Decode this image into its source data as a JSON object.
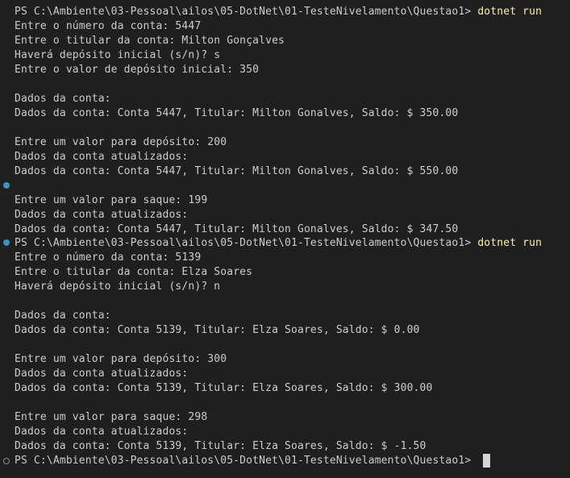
{
  "terminal": {
    "lines": [
      {
        "prompt": "PS C:\\Ambiente\\03-Pessoal\\ailos\\05-DotNet\\01-TesteNivelamento\\Questao1> ",
        "command": "dotnet run"
      },
      {
        "text": "Entre o número da conta: 5447"
      },
      {
        "text": "Entre o titular da conta: Milton Gonçalves"
      },
      {
        "text": "Haverá depósito inicial (s/n)? s"
      },
      {
        "text": "Entre o valor de depósito inicial: 350"
      },
      {
        "text": ""
      },
      {
        "text": "Dados da conta:"
      },
      {
        "text": "Dados da conta: Conta 5447, Titular: Milton Gonalves, Saldo: $ 350.00"
      },
      {
        "text": ""
      },
      {
        "text": "Entre um valor para depósito: 200"
      },
      {
        "text": "Dados da conta atualizados:"
      },
      {
        "text": "Dados da conta: Conta 5447, Titular: Milton Gonalves, Saldo: $ 550.00"
      },
      {
        "text": ""
      },
      {
        "text": "Entre um valor para saque: 199"
      },
      {
        "text": "Dados da conta atualizados:"
      },
      {
        "text": "Dados da conta: Conta 5447, Titular: Milton Gonalves, Saldo: $ 347.50"
      },
      {
        "prompt": "PS C:\\Ambiente\\03-Pessoal\\ailos\\05-DotNet\\01-TesteNivelamento\\Questao1> ",
        "command": "dotnet run"
      },
      {
        "text": "Entre o número da conta: 5139"
      },
      {
        "text": "Entre o titular da conta: Elza Soares"
      },
      {
        "text": "Haverá depósito inicial (s/n)? n"
      },
      {
        "text": ""
      },
      {
        "text": "Dados da conta:"
      },
      {
        "text": "Dados da conta: Conta 5139, Titular: Elza Soares, Saldo: $ 0.00"
      },
      {
        "text": ""
      },
      {
        "text": "Entre um valor para depósito: 300"
      },
      {
        "text": "Dados da conta atualizados:"
      },
      {
        "text": "Dados da conta: Conta 5139, Titular: Elza Soares, Saldo: $ 300.00"
      },
      {
        "text": ""
      },
      {
        "text": "Entre um valor para saque: 298"
      },
      {
        "text": "Dados da conta atualizados:"
      },
      {
        "text": "Dados da conta: Conta 5139, Titular: Elza Soares, Saldo: $ -1.50"
      },
      {
        "prompt": "PS C:\\Ambiente\\03-Pessoal\\ailos\\05-DotNet\\01-TesteNivelamento\\Questao1> ",
        "command": ""
      }
    ]
  },
  "colors": {
    "background": "#1f1f1f",
    "text": "#cccccc",
    "command": "#f9f1a5",
    "marker_done": "#3794c6"
  }
}
